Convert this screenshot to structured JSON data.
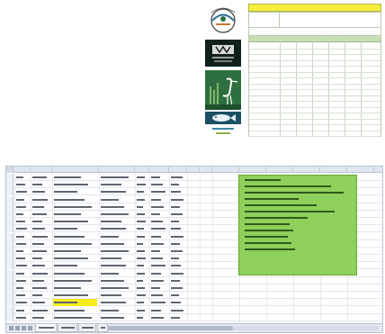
{
  "form_page": {
    "logos": [
      {
        "name": "emblem",
        "shape": "circular crest"
      },
      {
        "name": "dark-panel",
        "shape": "square badge"
      },
      {
        "name": "heron",
        "shape": "bird with reeds"
      },
      {
        "name": "fish",
        "shape": "fish silhouette"
      }
    ],
    "table_rows": 16,
    "table_columns": 7,
    "colors": {
      "title_bar": "#f2ee3a",
      "header_row": "#c6e0b4"
    }
  },
  "spreadsheet": {
    "columns": [
      "A",
      "B",
      "C",
      "D",
      "E",
      "F",
      "G",
      "H",
      "I",
      "J",
      "K",
      "L",
      "M",
      "N",
      "O"
    ],
    "row_numbers": [
      "1",
      "2",
      "3",
      "4",
      "5",
      "6",
      "7",
      "8",
      "9",
      "10",
      "11",
      "12",
      "13",
      "14",
      "15",
      "16",
      "17",
      "18",
      "19",
      "20"
    ],
    "highlight_row": 18,
    "notes_panel_color": "#8fcf5b",
    "sheet_tabs": 4,
    "active_tab": 0
  }
}
